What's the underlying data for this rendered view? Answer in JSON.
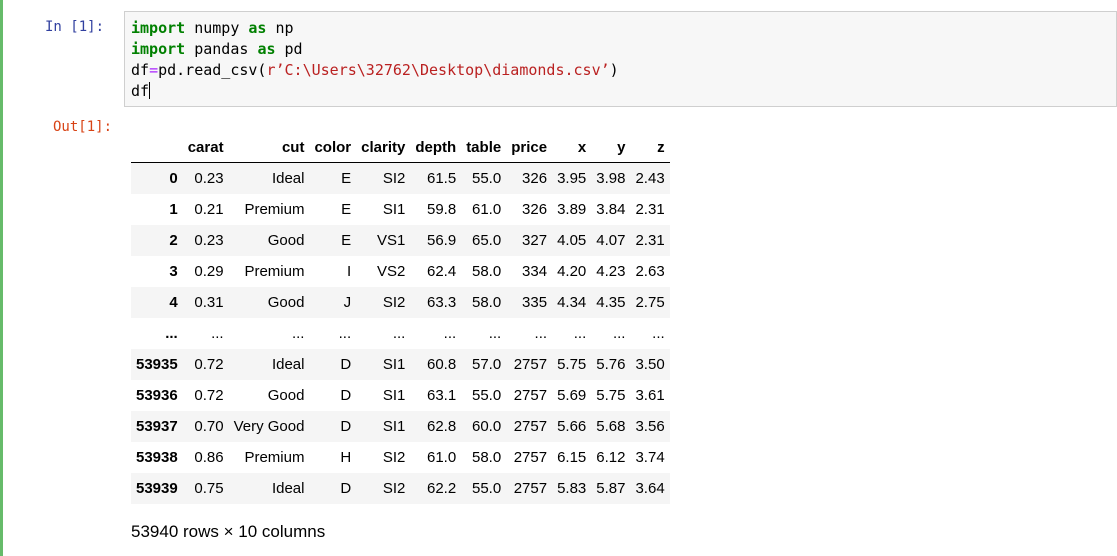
{
  "prompts": {
    "in": "In  [1]:",
    "out": "Out[1]:"
  },
  "code": {
    "line1": {
      "kw1": "import",
      "mod": " numpy ",
      "kw2": "as",
      "alias": " np"
    },
    "line2": {
      "kw1": "import",
      "mod": " pandas ",
      "kw2": "as",
      "alias": " pd"
    },
    "line3": {
      "var": "df",
      "eq": "=",
      "call": "pd.read_csv(",
      "str": "r’C:\\Users\\32762\\Desktop\\diamonds.csv’",
      "close": ")"
    },
    "line4": {
      "text": "df"
    }
  },
  "table": {
    "columns": [
      "",
      "carat",
      "cut",
      "color",
      "clarity",
      "depth",
      "table",
      "price",
      "x",
      "y",
      "z"
    ],
    "rows": [
      [
        "0",
        "0.23",
        "Ideal",
        "E",
        "SI2",
        "61.5",
        "55.0",
        "326",
        "3.95",
        "3.98",
        "2.43"
      ],
      [
        "1",
        "0.21",
        "Premium",
        "E",
        "SI1",
        "59.8",
        "61.0",
        "326",
        "3.89",
        "3.84",
        "2.31"
      ],
      [
        "2",
        "0.23",
        "Good",
        "E",
        "VS1",
        "56.9",
        "65.0",
        "327",
        "4.05",
        "4.07",
        "2.31"
      ],
      [
        "3",
        "0.29",
        "Premium",
        "I",
        "VS2",
        "62.4",
        "58.0",
        "334",
        "4.20",
        "4.23",
        "2.63"
      ],
      [
        "4",
        "0.31",
        "Good",
        "J",
        "SI2",
        "63.3",
        "58.0",
        "335",
        "4.34",
        "4.35",
        "2.75"
      ],
      [
        "...",
        "...",
        "...",
        "...",
        "...",
        "...",
        "...",
        "...",
        "...",
        "...",
        "..."
      ],
      [
        "53935",
        "0.72",
        "Ideal",
        "D",
        "SI1",
        "60.8",
        "57.0",
        "2757",
        "5.75",
        "5.76",
        "3.50"
      ],
      [
        "53936",
        "0.72",
        "Good",
        "D",
        "SI1",
        "63.1",
        "55.0",
        "2757",
        "5.69",
        "5.75",
        "3.61"
      ],
      [
        "53937",
        "0.70",
        "Very Good",
        "D",
        "SI1",
        "62.8",
        "60.0",
        "2757",
        "5.66",
        "5.68",
        "3.56"
      ],
      [
        "53938",
        "0.86",
        "Premium",
        "H",
        "SI2",
        "61.0",
        "58.0",
        "2757",
        "6.15",
        "6.12",
        "3.74"
      ],
      [
        "53939",
        "0.75",
        "Ideal",
        "D",
        "SI2",
        "62.2",
        "55.0",
        "2757",
        "5.83",
        "5.87",
        "3.64"
      ]
    ],
    "summary": "53940 rows × 10 columns"
  }
}
